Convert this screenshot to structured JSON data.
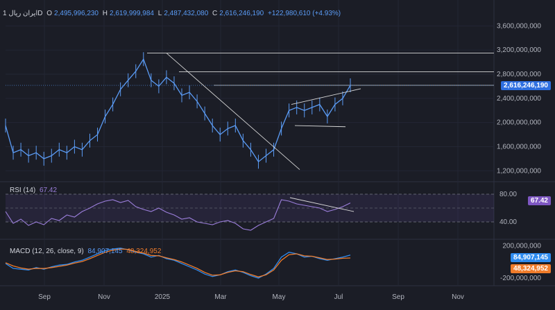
{
  "header": {
    "symbol": "1 ایران ریالD",
    "open_label": "O",
    "open": "2,495,996,230",
    "high_label": "H",
    "high": "2,619,999,984",
    "low_label": "L",
    "low": "2,487,432,080",
    "close_label": "C",
    "close": "2,616,246,190",
    "change": "+122,980,610 (+4.93%)"
  },
  "rsi": {
    "label": "RSI (14)",
    "value": "67.42",
    "levels": [
      "80.00",
      "40.00"
    ]
  },
  "macd": {
    "label": "MACD (12, 26, close, 9)",
    "macd_value": "84,907,145",
    "signal_value": "48,324,952",
    "ticks": [
      "200,000,000",
      "-200,000,000"
    ]
  },
  "price_tag": "2,616,246,190",
  "colors": {
    "price": "#5b9cf6",
    "rsi": "#9c7fdc",
    "macd": "#2f8cf0",
    "signal": "#f07c2b",
    "background": "#1b1d26"
  },
  "chart_data": [
    {
      "type": "line",
      "title": "",
      "x_ticks": [
        "Sep",
        "Nov",
        "2025",
        "Mar",
        "May",
        "Jul",
        "Sep",
        "Nov"
      ],
      "y_ticks": [
        "3,600,000,000",
        "3,200,000,000",
        "2,800,000,000",
        "2,400,000,000",
        "2,000,000,000",
        "1,600,000,000",
        "1,200,000,000"
      ],
      "ylim": [
        1100000000,
        3800000000
      ],
      "series": [
        {
          "x": [
            "2024-08-01",
            "2024-08-08",
            "2024-08-15",
            "2024-08-22",
            "2024-09-01",
            "2024-09-08",
            "2024-09-15",
            "2024-09-22",
            "2024-10-01",
            "2024-10-08",
            "2024-10-15",
            "2024-10-22",
            "2024-11-01",
            "2024-11-08",
            "2024-11-15",
            "2024-11-22",
            "2024-12-01",
            "2024-12-08",
            "2024-12-15",
            "2024-12-22",
            "2025-01-01",
            "2025-01-08",
            "2025-01-15",
            "2025-01-22",
            "2025-02-01",
            "2025-02-08",
            "2025-02-15",
            "2025-02-22",
            "2025-03-01",
            "2025-03-08",
            "2025-03-15",
            "2025-03-22",
            "2025-04-01",
            "2025-04-08",
            "2025-04-15",
            "2025-04-22",
            "2025-05-01",
            "2025-05-08",
            "2025-05-15",
            "2025-05-22",
            "2025-06-01",
            "2025-06-08",
            "2025-06-15",
            "2025-06-22",
            "2025-07-01",
            "2025-07-08"
          ],
          "values": [
            1950000000,
            1500000000,
            1550000000,
            1450000000,
            1500000000,
            1400000000,
            1450000000,
            1550000000,
            1500000000,
            1600000000,
            1550000000,
            1700000000,
            1800000000,
            2100000000,
            2300000000,
            2550000000,
            2700000000,
            2850000000,
            3050000000,
            2700000000,
            2600000000,
            2750000000,
            2650000000,
            2450000000,
            2500000000,
            2350000000,
            2150000000,
            1950000000,
            1800000000,
            1900000000,
            1950000000,
            1700000000,
            1550000000,
            1350000000,
            1450000000,
            1550000000,
            1900000000,
            2200000000,
            2250000000,
            2200000000,
            2250000000,
            2300000000,
            2100000000,
            2300000000,
            2400000000,
            2616246190
          ]
        }
      ],
      "horizontal_levels": [
        3150000000,
        2840000000,
        2616246190
      ],
      "current_price": 2616246190
    },
    {
      "type": "line",
      "title": "RSI (14)",
      "ylim": [
        20,
        90
      ],
      "bands": [
        80,
        40
      ],
      "series": [
        {
          "name": "RSI",
          "values": [
            55,
            38,
            44,
            35,
            40,
            36,
            45,
            42,
            50,
            47,
            55,
            60,
            66,
            70,
            72,
            68,
            71,
            62,
            58,
            55,
            60,
            54,
            50,
            44,
            46,
            40,
            38,
            36,
            40,
            42,
            38,
            30,
            28,
            35,
            40,
            45,
            72,
            70,
            66,
            64,
            62,
            60,
            55,
            58,
            62,
            67.42
          ]
        }
      ]
    },
    {
      "type": "line",
      "title": "MACD (12, 26, close, 9)",
      "ylim": [
        -260000000,
        220000000
      ],
      "series": [
        {
          "name": "MACD",
          "values": [
            -20000000,
            -80000000,
            -90000000,
            -100000000,
            -70000000,
            -90000000,
            -60000000,
            -40000000,
            -30000000,
            0,
            20000000,
            60000000,
            100000000,
            140000000,
            160000000,
            170000000,
            150000000,
            120000000,
            100000000,
            60000000,
            80000000,
            40000000,
            20000000,
            -20000000,
            -60000000,
            -100000000,
            -150000000,
            -180000000,
            -160000000,
            -120000000,
            -100000000,
            -130000000,
            -170000000,
            -200000000,
            -150000000,
            -80000000,
            60000000,
            120000000,
            100000000,
            60000000,
            70000000,
            40000000,
            20000000,
            40000000,
            60000000,
            84907145
          ]
        },
        {
          "name": "Signal",
          "values": [
            -10000000,
            -50000000,
            -75000000,
            -90000000,
            -80000000,
            -82000000,
            -70000000,
            -55000000,
            -40000000,
            -15000000,
            5000000,
            40000000,
            80000000,
            120000000,
            145000000,
            160000000,
            155000000,
            130000000,
            110000000,
            80000000,
            75000000,
            50000000,
            30000000,
            0,
            -40000000,
            -80000000,
            -130000000,
            -165000000,
            -160000000,
            -130000000,
            -110000000,
            -120000000,
            -155000000,
            -185000000,
            -160000000,
            -100000000,
            20000000,
            90000000,
            100000000,
            75000000,
            70000000,
            50000000,
            30000000,
            35000000,
            45000000,
            48324952
          ]
        }
      ]
    }
  ]
}
